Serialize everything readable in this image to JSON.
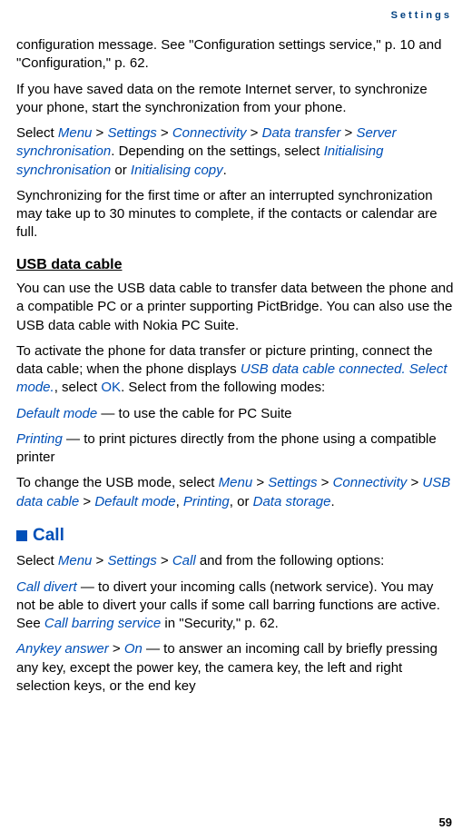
{
  "header": {
    "sectionLabel": "Settings"
  },
  "pageNumber": "59",
  "paras": {
    "p1a": "configuration message. See \"Configuration settings service,\" p. 10 and \"Configuration,\" p. 62.",
    "p2": "If you have saved data on the remote Internet server, to synchronize your phone, start the synchronization from your phone.",
    "p3": {
      "t1": "Select ",
      "menu": "Menu",
      "gt": " > ",
      "settings": "Settings",
      "connectivity": "Connectivity",
      "datatransfer": "Data transfer",
      "serversync": "Server synchronisation",
      "t2": ". Depending on the settings, select ",
      "initsync": "Initialising synchronisation",
      "t3": " or ",
      "initcopy": "Initialising copy",
      "t4": "."
    },
    "p4": "Synchronizing for the first time or after an interrupted synchronization may take up to 30 minutes to complete, if the contacts or calendar are full."
  },
  "usb": {
    "heading": "USB data cable",
    "p1": "You can use the USB data cable to transfer data between the phone and a compatible PC or a printer supporting PictBridge. You can also use the USB data cable with Nokia PC Suite.",
    "p2": {
      "t1": "To activate the phone for data transfer or picture printing, connect the data cable; when the phone displays ",
      "msg": "USB data cable connected. Select mode.",
      "t2": ", select ",
      "ok": "OK",
      "t3": ". Select from the following modes:"
    },
    "p3": {
      "mode": "Default mode",
      "t1": " — to use the cable for PC Suite"
    },
    "p4": {
      "mode": "Printing",
      "t1": " — to print pictures directly from the phone using a compatible printer"
    },
    "p5": {
      "t1": "To change the USB mode, select ",
      "menu": "Menu",
      "gt": " > ",
      "settings": "Settings",
      "connectivity": "Connectivity",
      "usbcable": "USB data cable",
      "defmode": "Default mode",
      "t2": ", ",
      "printing": "Printing",
      "t3": ", or ",
      "datastorage": "Data storage",
      "t4": "."
    }
  },
  "call": {
    "heading": "Call",
    "p1": {
      "t1": "Select ",
      "menu": "Menu",
      "gt": " > ",
      "settings": "Settings",
      "call": "Call",
      "t2": " and from the following options:"
    },
    "p2": {
      "opt": "Call divert",
      "t1": " — to divert your incoming calls (network service). You may not be able to divert your calls if some call barring functions are active. See ",
      "link": "Call barring service",
      "t2": " in \"Security,\" p. 62."
    },
    "p3": {
      "opt": "Anykey answer",
      "gt": " > ",
      "on": "On",
      "t1": " — to answer an incoming call by briefly pressing any key, except the power key, the camera key, the left and right selection keys, or the end key"
    }
  }
}
